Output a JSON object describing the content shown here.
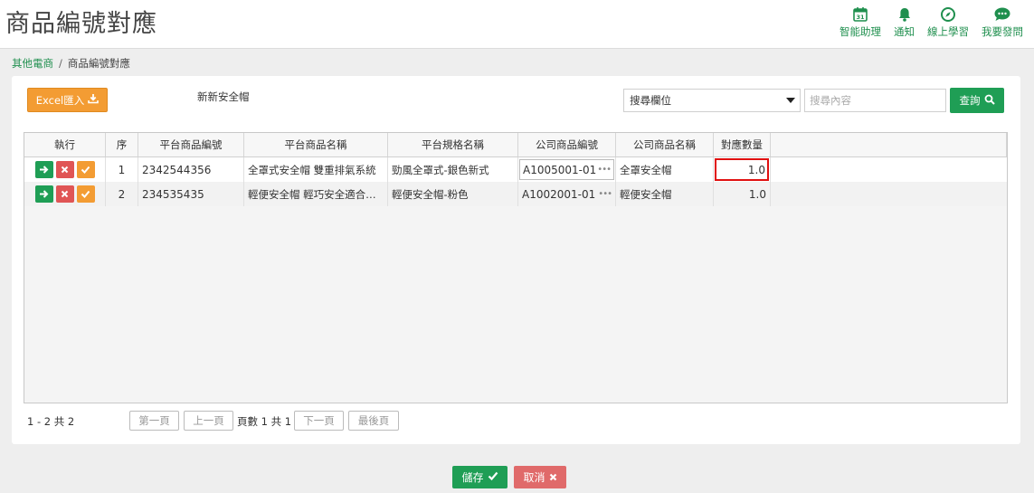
{
  "page": {
    "title": "商品編號對應"
  },
  "header_actions": [
    {
      "label": "智能助理",
      "icon": "calendar-icon"
    },
    {
      "label": "通知",
      "icon": "bell-icon"
    },
    {
      "label": "線上學習",
      "icon": "compass-icon"
    },
    {
      "label": "我要發問",
      "icon": "chat-icon"
    }
  ],
  "breadcrumb": {
    "parent": "其他電商",
    "separator": "/",
    "current": "商品編號對應"
  },
  "toolbar": {
    "excel_label": "Excel匯入",
    "import_filename": "新新安全帽",
    "field_select_value": "搜尋欄位",
    "search_placeholder": "搜尋內容",
    "query_label": "查詢"
  },
  "grid": {
    "columns": [
      "執行",
      "序",
      "平台商品編號",
      "平台商品名稱",
      "平台規格名稱",
      "公司商品編號",
      "公司商品名稱",
      "對應數量"
    ],
    "rows": [
      {
        "seq": "1",
        "platform_no": "2342544356",
        "platform_name": "全罩式安全帽 雙重排氣系統",
        "spec": "勁風全罩式-銀色新式",
        "company_no": "A1005001-01",
        "company_name": "全罩安全帽",
        "qty": "1.0"
      },
      {
        "seq": "2",
        "platform_no": "234535435",
        "platform_name": "輕便安全帽 輕巧安全適合通勤",
        "spec": "輕便安全帽-粉色",
        "company_no": "A1002001-01",
        "company_name": "輕便安全帽",
        "qty": "1.0"
      }
    ]
  },
  "pager": {
    "info": "1 - 2 共 2",
    "first": "第一頁",
    "prev": "上一頁",
    "page_text": "頁數 1 共 1",
    "next": "下一頁",
    "last": "最後頁"
  },
  "footer": {
    "save_label": "儲存",
    "cancel_label": "取消"
  },
  "colors": {
    "brand_green": "#1f9e55",
    "accent_orange": "#f39c33",
    "danger_red": "#e05555",
    "highlight_border": "#e01010"
  }
}
